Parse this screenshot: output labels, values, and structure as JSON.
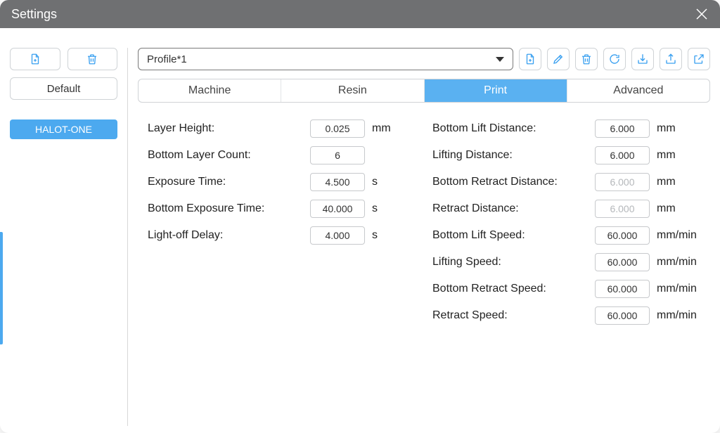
{
  "window": {
    "title": "Settings"
  },
  "sidebar": {
    "default_label": "Default",
    "device_label": "HALOT-ONE"
  },
  "profile": {
    "selected": "Profile*1"
  },
  "tabs": {
    "machine": "Machine",
    "resin": "Resin",
    "print": "Print",
    "advanced": "Advanced"
  },
  "left_params": [
    {
      "label": "Layer Height:",
      "value": "0.025",
      "unit": "mm",
      "disabled": false
    },
    {
      "label": "Bottom Layer Count:",
      "value": "6",
      "unit": "",
      "disabled": false
    },
    {
      "label": "Exposure Time:",
      "value": "4.500",
      "unit": "s",
      "disabled": false
    },
    {
      "label": "Bottom Exposure Time:",
      "value": "40.000",
      "unit": "s",
      "disabled": false
    },
    {
      "label": "Light-off Delay:",
      "value": "4.000",
      "unit": "s",
      "disabled": false
    }
  ],
  "right_params": [
    {
      "label": "Bottom Lift Distance:",
      "value": "6.000",
      "unit": "mm",
      "disabled": false
    },
    {
      "label": "Lifting Distance:",
      "value": "6.000",
      "unit": "mm",
      "disabled": false
    },
    {
      "label": "Bottom Retract Distance:",
      "value": "6.000",
      "unit": "mm",
      "disabled": true
    },
    {
      "label": "Retract Distance:",
      "value": "6.000",
      "unit": "mm",
      "disabled": true
    },
    {
      "label": "Bottom Lift Speed:",
      "value": "60.000",
      "unit": "mm/min",
      "disabled": false
    },
    {
      "label": "Lifting Speed:",
      "value": "60.000",
      "unit": "mm/min",
      "disabled": false
    },
    {
      "label": "Bottom Retract Speed:",
      "value": "60.000",
      "unit": "mm/min",
      "disabled": false
    },
    {
      "label": "Retract Speed:",
      "value": "60.000",
      "unit": "mm/min",
      "disabled": false
    }
  ]
}
